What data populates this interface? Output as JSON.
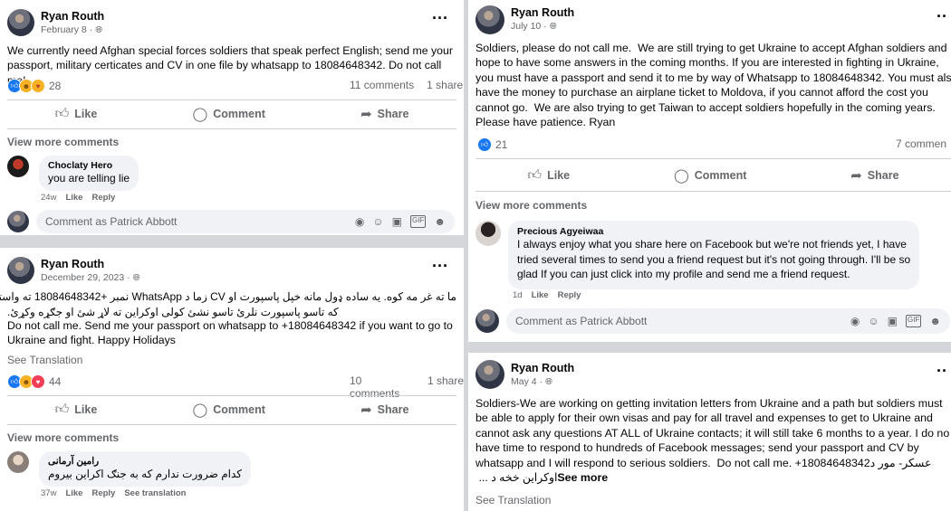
{
  "posts": [
    {
      "author": "Ryan Routh",
      "date": "February 8 ·",
      "body": "We currently need Afghan special forces soldiers that speak perfect English; send me your\npassport, military certicates and CV in one file by whatsapp to 18084648342. Do not call me!",
      "reactions": [
        "like-icon",
        "haha-icon",
        "care-icon"
      ],
      "reaction_count": "28",
      "comments_count": "11 comments",
      "shares_count": "1 share",
      "actions": {
        "like": "Like",
        "comment": "Comment",
        "share": "Share"
      },
      "view_more": "View more comments",
      "comment": {
        "name": "Choclaty Hero",
        "text": "you are telling lie",
        "time": "24w",
        "like": "Like",
        "reply": "Reply"
      },
      "input_placeholder": "Comment as Patrick Abbott"
    },
    {
      "author": "Ryan Routh",
      "date": "December 29, 2023 ·",
      "body_rtl_1": "ما ته غر مه کوه.  یه ساده ډول مانه خپل پاسپورت او CV زما د WhatsApp نمبر +18084648342 ته واستوئ",
      "body_rtl_2": "که تاسو پاسپورت نلرئ تاسو نشئ کولی اوکراین ته لاړ شئ او جګړه وکړئ.",
      "body": "Do not call me. Send me your passport on whatsapp to +18084648342 if you want to go to\nUkraine and fight. Happy Holidays",
      "see_translation": "See Translation",
      "reactions": [
        "like-icon",
        "haha-icon",
        "love-icon"
      ],
      "reaction_count": "44",
      "comments_count": "10 comments",
      "shares_count": "1 share",
      "actions": {
        "like": "Like",
        "comment": "Comment",
        "share": "Share"
      },
      "view_more": "View more comments",
      "comment": {
        "name": "رامین آرمانی",
        "text": "کدام ضرورت ندارم که به جنګ اکراین بیروم",
        "time": "37w",
        "like": "Like",
        "reply": "Reply",
        "translate": "See translation"
      }
    },
    {
      "author": "Ryan Routh",
      "date": "July 10 ·",
      "body": "Soldiers, please do not call me.  We are still trying to get Ukraine to accept Afghan soldiers and\nhope to have some answers in the coming months. If you are interested in fighting in Ukraine,\nyou must have a passport and send it to me by way of Whatsapp to 18084648342. You must als\nhave the money to purchase an airplane ticket to Moldova, if you cannot afford the cost you\ncannot go.  We are also trying to get Taiwan to accept soldiers hopefully in the coming years.\nPlease have patience. Ryan",
      "reactions": [
        "like-icon"
      ],
      "reaction_count": "21",
      "comments_count": "7 commen",
      "actions": {
        "like": "Like",
        "comment": "Comment",
        "share": "Share"
      },
      "view_more": "View more comments",
      "comment": {
        "name": "Precious Agyeiwaa",
        "text": "I always enjoy what you share here on Facebook but we're not friends yet, I have\ntried several times to send you a friend request but it's not going through. I'll be so\nglad If you can just click into my profile and send me a friend request.",
        "time": "1d",
        "like": "Like",
        "reply": "Reply"
      },
      "input_placeholder": "Comment as Patrick Abbott"
    },
    {
      "author": "Ryan Routh",
      "date": "May 4 ·",
      "body": "Soldiers-We are working on getting invitation letters from Ukraine and a path but soldiers must\nbe able to apply for their own visas and pay for all travel and expenses to get to Ukraine and\ncannot ask any questions AT ALL of Ukraine contacts; it will still take 6 months to a year. I do no\nhave time to respond to hundreds of Facebook messages; send your passport and CV by\nwhatsapp and I will respond to serious soldiers.  Do not call me. +18084648342عسکر- مور د",
      "body_last": "اوکراین خخه د ... ",
      "see_more": "See more",
      "see_translation": "See Translation"
    }
  ],
  "composer_icons": [
    "sticker-icon",
    "emoji-icon",
    "camera-icon",
    "gif-icon",
    "smiley-sticker-icon"
  ]
}
